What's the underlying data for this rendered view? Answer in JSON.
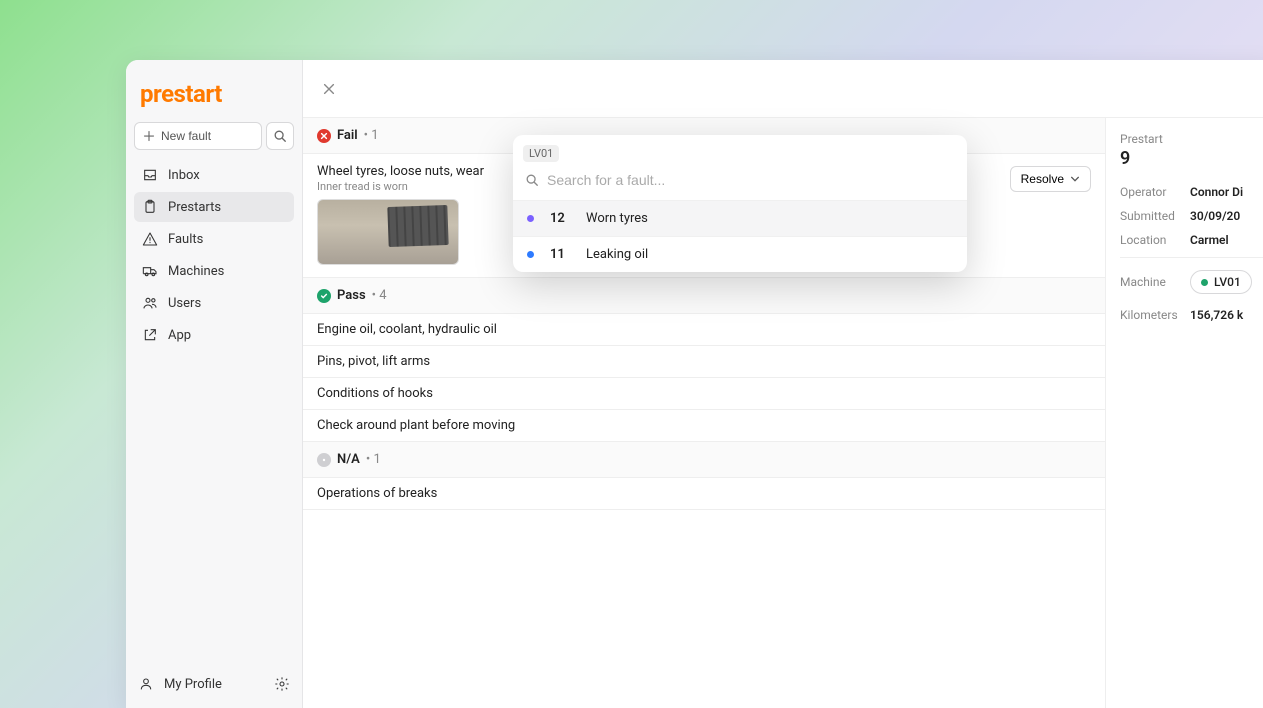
{
  "logo": "prestart",
  "sidebar": {
    "newFault": "New fault",
    "items": [
      {
        "label": "Inbox"
      },
      {
        "label": "Prestarts"
      },
      {
        "label": "Faults"
      },
      {
        "label": "Machines"
      },
      {
        "label": "Users"
      },
      {
        "label": "App"
      }
    ],
    "profile": "My Profile"
  },
  "sections": {
    "fail": {
      "title": "Fail",
      "count": "• 1"
    },
    "pass": {
      "title": "Pass",
      "count": "• 4"
    },
    "na": {
      "title": "N/A",
      "count": "• 1"
    }
  },
  "failItem": {
    "title": "Wheel tyres, loose nuts, wear",
    "note": "Inner tread is worn",
    "resolve": "Resolve"
  },
  "passItems": [
    "Engine oil, coolant, hydraulic oil",
    "Pins, pivot, lift arms",
    "Conditions of hooks",
    "Check around plant before moving"
  ],
  "naItems": [
    "Operations of breaks"
  ],
  "popup": {
    "tag": "LV01",
    "placeholder": "Search for a fault...",
    "options": [
      {
        "id": "12",
        "label": "Worn tyres",
        "color": "#7b61ff"
      },
      {
        "id": "11",
        "label": "Leaking oil",
        "color": "#2e7bff"
      }
    ]
  },
  "detail": {
    "groupLabel": "Prestart",
    "number": "9",
    "operatorK": "Operator",
    "operatorV": "Connor Di",
    "submittedK": "Submitted",
    "submittedV": "30/09/20",
    "locationK": "Location",
    "locationV": "Carmel",
    "machineK": "Machine",
    "machineV": "LV01",
    "kmK": "Kilometers",
    "kmV": "156,726 k"
  }
}
